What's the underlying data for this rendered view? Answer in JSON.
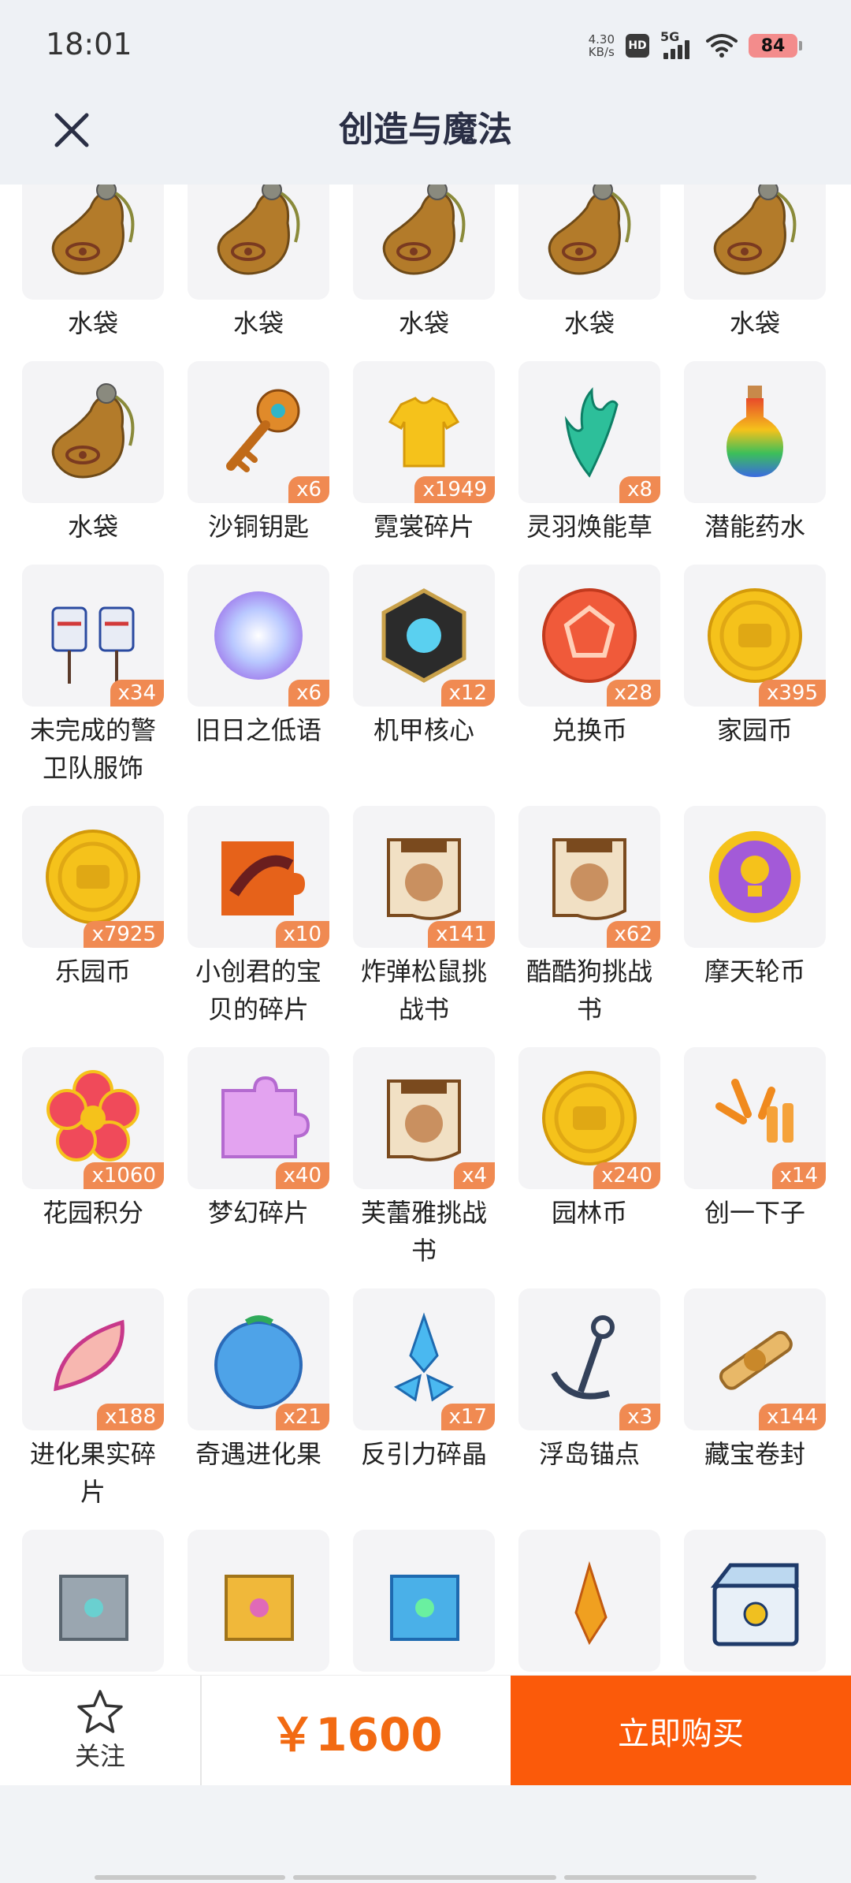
{
  "status_bar": {
    "time": "18:01",
    "net_speed_value": "4.30",
    "net_speed_unit": "KB/s",
    "hd_label": "HD",
    "signal_label": "5G",
    "battery": "84"
  },
  "header": {
    "title": "创造与魔法",
    "close_icon": "close-icon"
  },
  "items": [
    {
      "name": "水袋",
      "qty": "",
      "icon": "water-bag"
    },
    {
      "name": "水袋",
      "qty": "",
      "icon": "water-bag"
    },
    {
      "name": "水袋",
      "qty": "",
      "icon": "water-bag"
    },
    {
      "name": "水袋",
      "qty": "",
      "icon": "water-bag"
    },
    {
      "name": "水袋",
      "qty": "",
      "icon": "water-bag"
    },
    {
      "name": "水袋",
      "qty": "",
      "icon": "water-bag"
    },
    {
      "name": "沙铜钥匙",
      "qty": "x6",
      "icon": "key"
    },
    {
      "name": "霓裳碎片",
      "qty": "x1949",
      "icon": "shirt"
    },
    {
      "name": "灵羽焕能草",
      "qty": "x8",
      "icon": "feather-grass"
    },
    {
      "name": "潜能药水",
      "qty": "",
      "icon": "potion"
    },
    {
      "name": "未完成的警卫队服饰",
      "qty": "x34",
      "icon": "outfit"
    },
    {
      "name": "旧日之低语",
      "qty": "x6",
      "icon": "orb"
    },
    {
      "name": "机甲核心",
      "qty": "x12",
      "icon": "mech-core"
    },
    {
      "name": "兑换币",
      "qty": "x28",
      "icon": "red-coin"
    },
    {
      "name": "家园币",
      "qty": "x395",
      "icon": "gold-coin"
    },
    {
      "name": "乐园币",
      "qty": "x7925",
      "icon": "gold-coin"
    },
    {
      "name": "小创君的宝贝的碎片",
      "qty": "x10",
      "icon": "puzzle-art"
    },
    {
      "name": "炸弹松鼠挑战书",
      "qty": "x141",
      "icon": "wanted-scroll"
    },
    {
      "name": "酷酷狗挑战书",
      "qty": "x62",
      "icon": "wanted-scroll"
    },
    {
      "name": "摩天轮币",
      "qty": "",
      "icon": "purple-coin"
    },
    {
      "name": "花园积分",
      "qty": "x1060",
      "icon": "flower"
    },
    {
      "name": "梦幻碎片",
      "qty": "x40",
      "icon": "puzzle-pink"
    },
    {
      "name": "芙蕾雅挑战书",
      "qty": "x4",
      "icon": "wanted-scroll"
    },
    {
      "name": "园林币",
      "qty": "x240",
      "icon": "gold-coin"
    },
    {
      "name": "创一下子",
      "qty": "x14",
      "icon": "exclaim"
    },
    {
      "name": "进化果实碎片",
      "qty": "x188",
      "icon": "fruit-slice"
    },
    {
      "name": "奇遇进化果",
      "qty": "x21",
      "icon": "blue-fruit"
    },
    {
      "name": "反引力碎晶",
      "qty": "x17",
      "icon": "crystal"
    },
    {
      "name": "浮岛锚点",
      "qty": "x3",
      "icon": "anchor"
    },
    {
      "name": "藏宝卷封",
      "qty": "x144",
      "icon": "treasure-scroll"
    },
    {
      "name": "",
      "qty": "",
      "icon": "puzzle-gray"
    },
    {
      "name": "",
      "qty": "",
      "icon": "puzzle-gold"
    },
    {
      "name": "",
      "qty": "",
      "icon": "puzzle-blue"
    },
    {
      "name": "",
      "qty": "",
      "icon": "gem-shard"
    },
    {
      "name": "",
      "qty": "",
      "icon": "chest"
    }
  ],
  "bottom_bar": {
    "follow_label": "关注",
    "follow_icon": "star-icon",
    "price": "￥1600",
    "buy_label": "立即购买"
  },
  "colors": {
    "accent": "#fb5a0a",
    "price": "#f26a12",
    "badge": "#f08a52",
    "title": "#2a2f45"
  }
}
